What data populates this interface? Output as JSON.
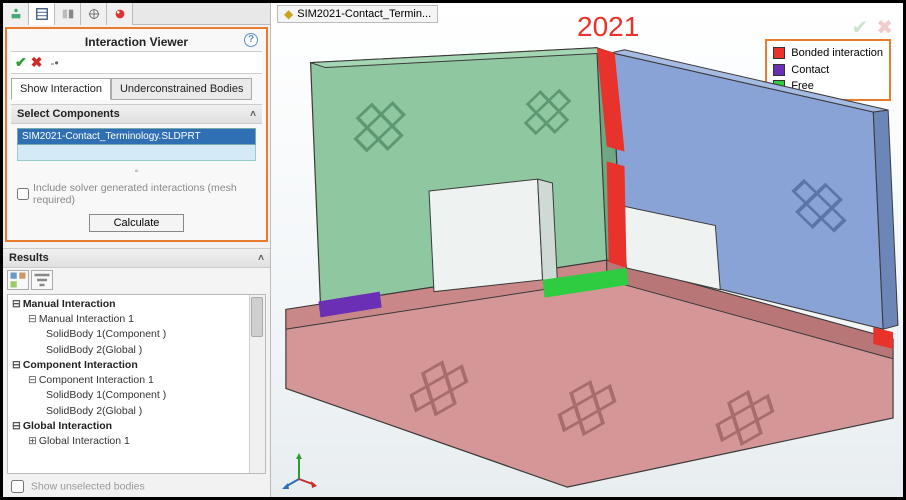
{
  "panel": {
    "title": "Interaction Viewer",
    "ok_tip": "OK",
    "cancel_tip": "Cancel",
    "pin_tip": "Pin",
    "help_tip": "?",
    "subtabs": {
      "show": "Show Interaction",
      "under": "Underconstrained Bodies"
    },
    "select_header": "Select Components",
    "selected_component": "SIM2021-Contact_Terminology.SLDPRT",
    "include_solver": "Include solver generated interactions (mesh required)",
    "calculate": "Calculate",
    "results_header": "Results",
    "tree": {
      "manual": "Manual Interaction",
      "manual1": "Manual Interaction 1",
      "comp_solid1": "SolidBody 1(Component  )",
      "global_solid2": "SolidBody 2(Global  )",
      "component": "Component Interaction",
      "component1": "Component Interaction 1",
      "global": "Global Interaction",
      "global1": "Global Interaction 1"
    },
    "show_unselected": "Show unselected bodies"
  },
  "document": {
    "tab_label": "SIM2021-Contact_Termin..."
  },
  "annotation": {
    "year": "2021"
  },
  "legend": {
    "bonded": {
      "label": "Bonded interaction",
      "color": "#e8322c"
    },
    "contact": {
      "label": "Contact",
      "color": "#6a2fb5"
    },
    "free": {
      "label": "Free",
      "color": "#2ecc40"
    }
  },
  "colors": {
    "green_face": "#8fc7a0",
    "blue_face": "#8aa3d6",
    "red_face": "#d49696",
    "edge": "#3a3a3a",
    "highlight_red": "#e8322c",
    "highlight_purple": "#6a2fb5",
    "highlight_green": "#2ecc40",
    "orange": "#e87b2e"
  }
}
